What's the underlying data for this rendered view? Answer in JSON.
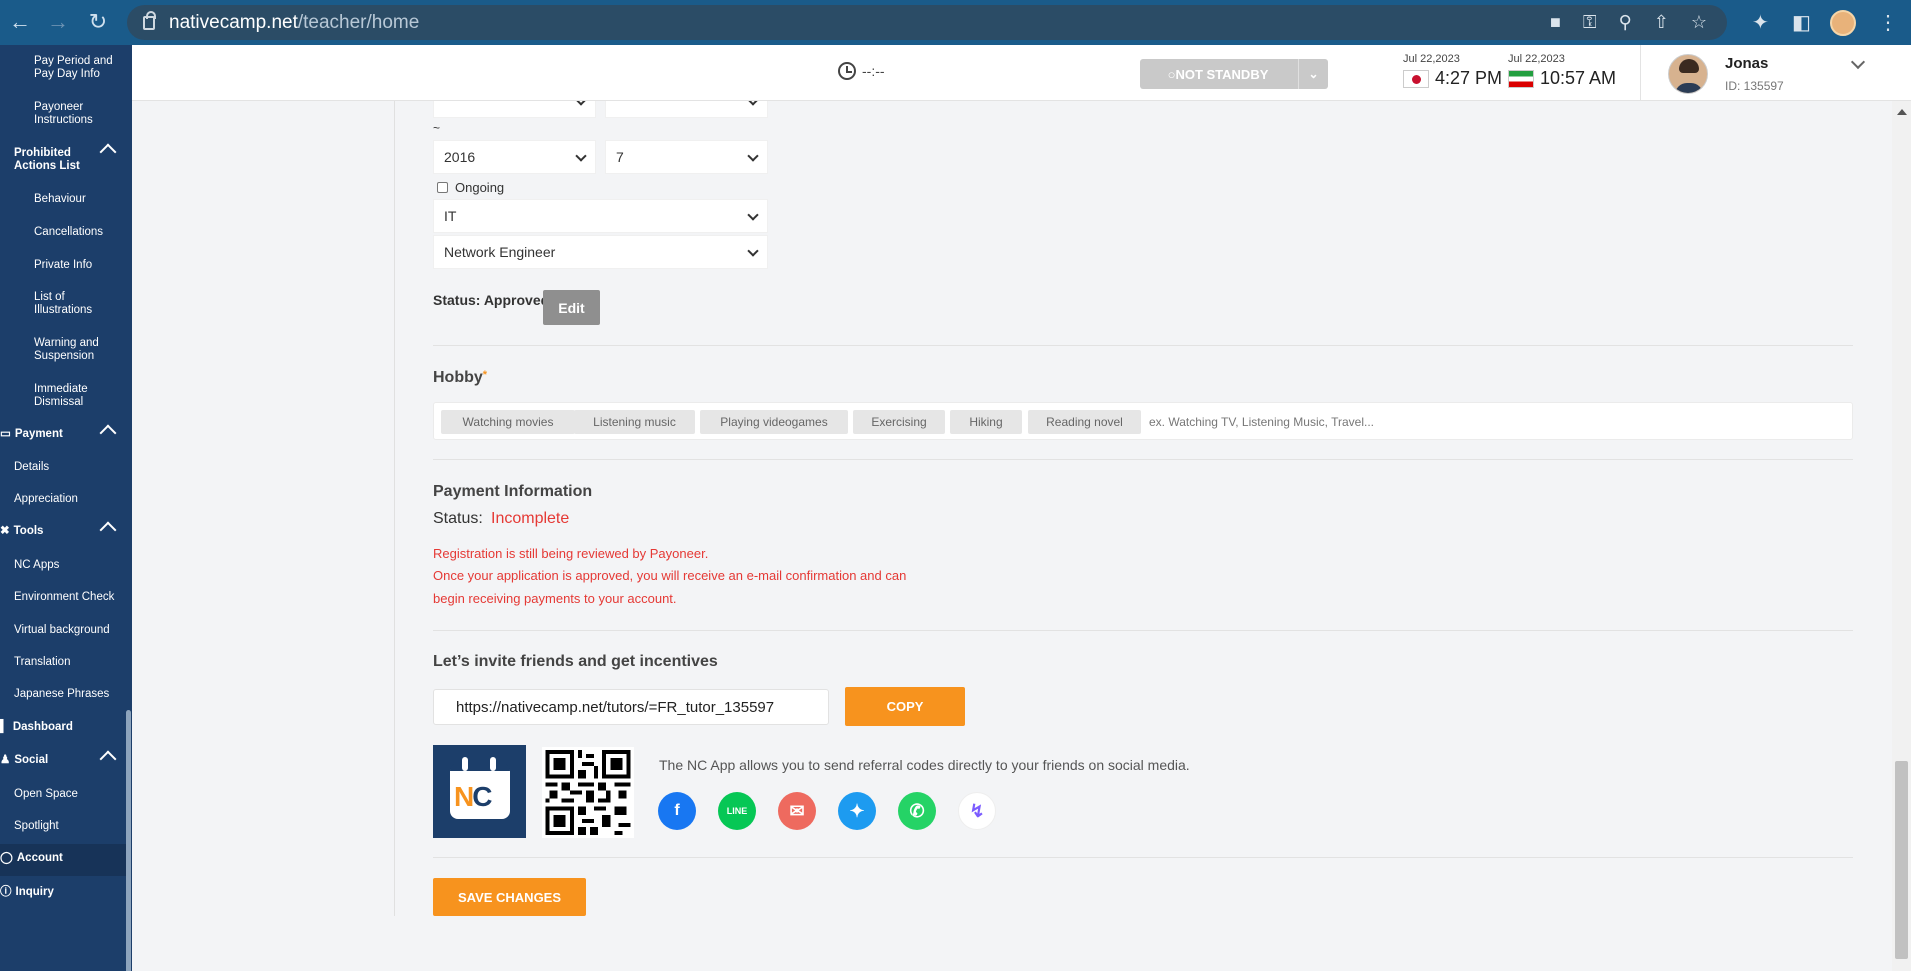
{
  "browser": {
    "url_host": "nativecamp.net",
    "url_path": "/teacher/home"
  },
  "sidebar": {
    "items": [
      {
        "label": "Pay Period and Pay Day Info"
      },
      {
        "label": "Payoneer Instructions"
      },
      {
        "label": "Prohibited Actions List"
      },
      {
        "label": "Behaviour"
      },
      {
        "label": "Cancellations"
      },
      {
        "label": "Private Info"
      },
      {
        "label": "List of Illustrations"
      },
      {
        "label": "Warning and Suspension"
      },
      {
        "label": "Immediate Dismissal"
      },
      {
        "label": "Payment"
      },
      {
        "label": "Details"
      },
      {
        "label": "Appreciation"
      },
      {
        "label": "Tools"
      },
      {
        "label": "NC Apps"
      },
      {
        "label": "Environment Check"
      },
      {
        "label": "Virtual background"
      },
      {
        "label": "Translation"
      },
      {
        "label": "Japanese Phrases"
      },
      {
        "label": "Dashboard"
      },
      {
        "label": "Social"
      },
      {
        "label": "Open Space"
      },
      {
        "label": "Spotlight"
      },
      {
        "label": "Account"
      },
      {
        "label": "Inquiry"
      }
    ]
  },
  "header": {
    "timer": "--:--",
    "standby_label": "NOT STANDBY",
    "tz1": {
      "date": "Jul 22,2023",
      "time": "4:27 PM"
    },
    "tz2": {
      "date": "Jul 22,2023",
      "time": "10:57 AM"
    },
    "user_name": "Jonas",
    "user_id": "ID: 135597"
  },
  "career": {
    "tilde": "~",
    "end_year": "2016",
    "end_month": "7",
    "ongoing_label": "Ongoing",
    "industry": "IT",
    "position": "Network Engineer",
    "status_label": "Status: Approved",
    "edit_label": "Edit"
  },
  "hobby": {
    "title": "Hobby",
    "required_mark": "*",
    "tags": [
      "Watching movies",
      "Listening music",
      "Playing videogames",
      "Exercising",
      "Hiking",
      "Reading novel"
    ],
    "placeholder": "ex. Watching TV, Listening Music, Travel..."
  },
  "payment": {
    "title": "Payment Information",
    "status_label": "Status:",
    "status_value": "Incomplete",
    "status_color": "#e53935",
    "note_line1": "Registration is still being reviewed by Payoneer.",
    "note_line2": "Once your application is approved, you will receive an e-mail confirmation and can",
    "note_line3": "begin receiving payments to your account."
  },
  "invite": {
    "title": "Let’s invite friends and get incentives",
    "referral_url": "https://nativecamp.net/tutors/=FR_tutor_135597",
    "copy_label": "COPY",
    "app_description": "The NC App allows you to send referral codes directly to your friends on social media.",
    "logo_text_n": "N",
    "logo_text_c": "C",
    "social_icons": [
      "facebook-icon",
      "line-icon",
      "mail-icon",
      "twitter-icon",
      "whatsapp-icon",
      "messenger-icon"
    ],
    "line_text": "LINE"
  },
  "save_label": "SAVE CHANGES",
  "colors": {
    "sidebar": "#1c3e6a",
    "accent": "#f7931e",
    "browser_bar": "#1a5b8a"
  }
}
